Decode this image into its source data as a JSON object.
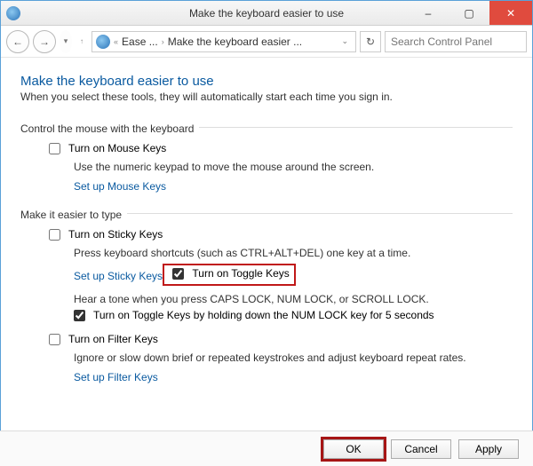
{
  "window": {
    "title": "Make the keyboard easier to use",
    "min_label": "–",
    "max_label": "▢",
    "close_label": "✕"
  },
  "nav": {
    "back": "←",
    "fwd": "→",
    "refresh": "↻",
    "breadcrumb_prefix": "«",
    "crumb1": "Ease ...",
    "crumb2": "Make the keyboard easier ...",
    "search_placeholder": "Search Control Panel"
  },
  "page": {
    "title": "Make the keyboard easier to use",
    "intro": "When you select these tools, they will automatically start each time you sign in."
  },
  "mouse_section": {
    "label": "Control the mouse with the keyboard",
    "mousekeys_label": "Turn on Mouse Keys",
    "mousekeys_desc": "Use the numeric keypad to move the mouse around the screen.",
    "mousekeys_link": "Set up Mouse Keys"
  },
  "type_section": {
    "label": "Make it easier to type",
    "sticky_label": "Turn on Sticky Keys",
    "sticky_desc": "Press keyboard shortcuts (such as CTRL+ALT+DEL) one key at a time.",
    "sticky_link": "Set up Sticky Keys",
    "toggle_label": "Turn on Toggle Keys",
    "toggle_desc": "Hear a tone when you press CAPS LOCK, NUM LOCK, or SCROLL LOCK.",
    "toggle_sub_label": "Turn on Toggle Keys by holding down the NUM LOCK key for 5 seconds",
    "filter_label": "Turn on Filter Keys",
    "filter_desc": "Ignore or slow down brief or repeated keystrokes and adjust keyboard repeat rates.",
    "filter_link": "Set up Filter Keys"
  },
  "footer": {
    "ok": "OK",
    "cancel": "Cancel",
    "apply": "Apply"
  },
  "state": {
    "mousekeys": false,
    "sticky": false,
    "toggle": true,
    "toggle_sub": true,
    "filter": false
  }
}
